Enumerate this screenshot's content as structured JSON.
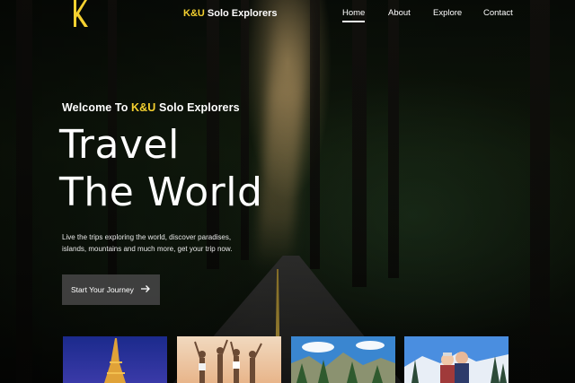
{
  "nav": {
    "brand_prefix": "K&U",
    "brand_suffix": " Solo Explorers",
    "links": [
      {
        "label": "Home",
        "active": true
      },
      {
        "label": "About",
        "active": false
      },
      {
        "label": "Explore",
        "active": false
      },
      {
        "label": "Contact",
        "active": false
      }
    ]
  },
  "hero": {
    "welcome_prefix": "Welcome To ",
    "welcome_brand": "K&U",
    "welcome_suffix": " Solo Explorers",
    "title_line1": "Travel",
    "title_line2": "The World",
    "description": "Live the trips exploring the world, discover paradises, islands, mountains and much more, get your trip now.",
    "cta_label": "Start Your Journey"
  },
  "cards": [
    {
      "icon": "eiffel-tower-image"
    },
    {
      "icon": "beach-friends-image"
    },
    {
      "icon": "mountain-forest-image"
    },
    {
      "icon": "snowy-couple-image"
    }
  ],
  "colors": {
    "accent": "#f5d130"
  }
}
